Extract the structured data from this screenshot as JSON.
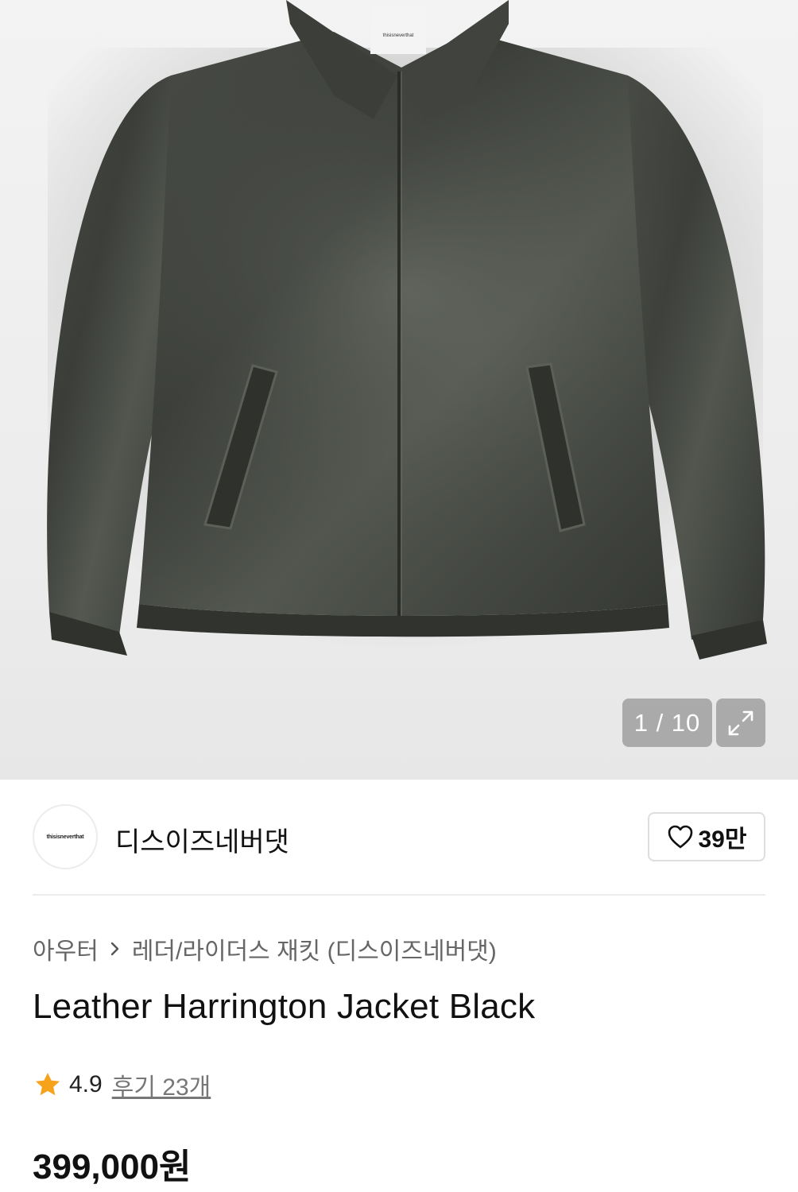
{
  "gallery": {
    "counter": "1 / 10",
    "label_tag": "thisisneverthat"
  },
  "brand": {
    "logo_text": "thisisneverthat",
    "name": "디스이즈네버댓",
    "likes": "39만"
  },
  "breadcrumb": {
    "category": "아우터",
    "subcategory": "레더/라이더스 재킷 (디스이즈네버댓)"
  },
  "product": {
    "title": "Leather Harrington Jacket Black",
    "rating": "4.9",
    "reviews": "후기 23개",
    "price": "399,000원"
  },
  "colors": {
    "star": "#f7a21b",
    "overlay": "#969696"
  }
}
